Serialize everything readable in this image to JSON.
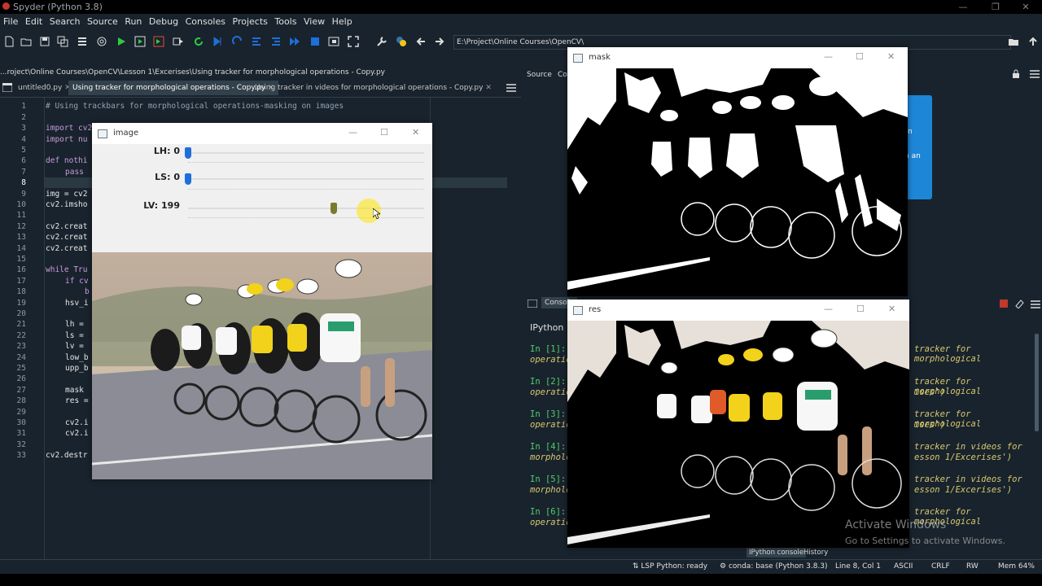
{
  "titlebar": {
    "title": "Spyder (Python 3.8)"
  },
  "menu": [
    "File",
    "Edit",
    "Search",
    "Source",
    "Run",
    "Debug",
    "Consoles",
    "Projects",
    "Tools",
    "View",
    "Help"
  ],
  "toolbar": {
    "path": "E:\\Project\\Online Courses\\OpenCV\\"
  },
  "editor": {
    "path": "...roject\\Online Courses\\OpenCV\\Lesson 1\\Excerises\\Using tracker for morphological operations - Copy.py",
    "tabs": [
      {
        "label": "untitled0.py"
      },
      {
        "label": "Using tracker for morphological operations - Copy.py"
      },
      {
        "label": "Using tracker in videos for morphological operations - Copy.py"
      }
    ],
    "line_numbers": [
      "1",
      "2",
      "3",
      "4",
      "5",
      "6",
      "7",
      "8",
      "9",
      "10",
      "11",
      "12",
      "13",
      "14",
      "15",
      "16",
      "17",
      "18",
      "19",
      "20",
      "21",
      "22",
      "23",
      "24",
      "25",
      "26",
      "27",
      "28",
      "29",
      "30",
      "31",
      "32",
      "33"
    ],
    "lines": {
      "l1": "# Using trackbars for morphological operations-masking on images",
      "l3": "import cv2",
      "l4": "import nu",
      "l6": "def nothi",
      "l7": "pass",
      "l9": "img = cv2",
      "l10": "cv2.imsho",
      "l12": "cv2.creat",
      "l13": "cv2.creat",
      "l14": "cv2.creat",
      "l16": "while Tru",
      "l17": "if cv",
      "l18": "b",
      "l19": "hsv_i",
      "l21": "lh =",
      "l22": "ls =",
      "l23": "lv =",
      "l24": "low_b",
      "l25": "upp_b",
      "l27": "mask",
      "l28": "res =",
      "l30": "cv2.i",
      "l31": "cv2.i",
      "l33": "cv2.destr"
    }
  },
  "right_panel": {
    "tabs": [
      "Source",
      "Co"
    ]
  },
  "console": {
    "tab_label": "Console",
    "header": "IPython",
    "entries": [
      {
        "prompt": "In [1]:",
        "text": "operatio",
        "tail1": "tracker for morphological",
        "tail2": ""
      },
      {
        "prompt": "In [2]:",
        "text": "operatio",
        "tail1": "tracker for morphological",
        "tail2": "ises')"
      },
      {
        "prompt": "In [3]:",
        "text": "operatio",
        "tail1": "tracker for morphological",
        "tail2": "ises')"
      },
      {
        "prompt": "In [4]:",
        "text": "morpholo",
        "tail1": "tracker in videos for",
        "tail2": "esson 1/Excerises')"
      },
      {
        "prompt": "In [5]:",
        "text": "morpholo",
        "tail1": "tracker in videos for",
        "tail2": "esson 1/Excerises')"
      },
      {
        "prompt": "In [6]:",
        "text": "operatio",
        "tail1": "tracker for morphological",
        "tail2": ""
      }
    ],
    "bottom_tabs": [
      "IPython console",
      "History"
    ]
  },
  "popup_hint": {
    "line1": "n",
    "line2": "n an"
  },
  "image_window": {
    "title": "image",
    "trackbars": [
      {
        "label": "LH: 0",
        "value": 0,
        "max": 179
      },
      {
        "label": "LS: 0",
        "value": 0,
        "max": 255
      },
      {
        "label": "LV: 199",
        "value": 199,
        "max": 255
      }
    ]
  },
  "mask_window": {
    "title": "mask"
  },
  "res_window": {
    "title": "res"
  },
  "statusbar": {
    "lsp": "LSP Python: ready",
    "conda": "conda: base (Python 3.8.3)",
    "position": "Line 8, Col 1",
    "encoding": "ASCII",
    "eol": "CRLF",
    "rw": "RW",
    "mem": "Mem 64%"
  },
  "watermark": {
    "line1": "Activate Windows",
    "line2": "Go to Settings to activate Windows."
  },
  "colors": {
    "bg": "#19232d",
    "accent": "#1e6fd9",
    "prompt": "#4fcf6b"
  }
}
